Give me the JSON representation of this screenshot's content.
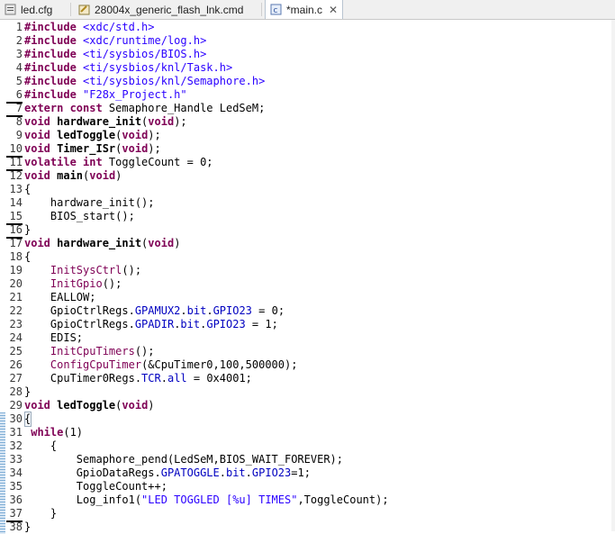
{
  "tabs": [
    {
      "label": "led.cfg",
      "icon": "config-file-icon",
      "active": false
    },
    {
      "label": "28004x_generic_flash_lnk.cmd",
      "icon": "linker-file-icon",
      "active": false
    },
    {
      "label": "*main.c",
      "icon": "c-source-file-icon",
      "active": true
    }
  ],
  "close_glyph": "✕",
  "lines": [
    {
      "n": "1",
      "mark": false,
      "tokens": [
        [
          "dir",
          "#include "
        ],
        [
          "str",
          "<xdc/std.h>"
        ]
      ]
    },
    {
      "n": "2",
      "mark": false,
      "tokens": [
        [
          "dir",
          "#include "
        ],
        [
          "str",
          "<xdc/runtime/log.h>"
        ]
      ]
    },
    {
      "n": "3",
      "mark": false,
      "tokens": [
        [
          "dir",
          "#include "
        ],
        [
          "str",
          "<ti/sysbios/BIOS.h>"
        ]
      ]
    },
    {
      "n": "4",
      "mark": false,
      "tokens": [
        [
          "dir",
          "#include "
        ],
        [
          "str",
          "<ti/sysbios/knl/Task.h>"
        ]
      ]
    },
    {
      "n": "5",
      "mark": false,
      "tokens": [
        [
          "dir",
          "#include "
        ],
        [
          "str",
          "<ti/sysbios/knl/Semaphore.h>"
        ]
      ]
    },
    {
      "n": "6",
      "mark": true,
      "tokens": [
        [
          "dir",
          "#include "
        ],
        [
          "str",
          "\"F28x_Project.h\""
        ]
      ]
    },
    {
      "n": "7",
      "mark": true,
      "tokens": [
        [
          "kw",
          "extern const "
        ],
        [
          "plain",
          "Semaphore_Handle LedSeM;"
        ]
      ]
    },
    {
      "n": "8",
      "mark": false,
      "tokens": [
        [
          "kw",
          "void "
        ],
        [
          "fn",
          "hardware_init"
        ],
        [
          "plain",
          "("
        ],
        [
          "kw",
          "void"
        ],
        [
          "plain",
          ");"
        ]
      ]
    },
    {
      "n": "9",
      "mark": false,
      "tokens": [
        [
          "kw",
          "void "
        ],
        [
          "fn",
          "ledToggle"
        ],
        [
          "plain",
          "("
        ],
        [
          "kw",
          "void"
        ],
        [
          "plain",
          ");"
        ]
      ]
    },
    {
      "n": "10",
      "mark": true,
      "tokens": [
        [
          "kw",
          "void "
        ],
        [
          "fn",
          "Timer_ISr"
        ],
        [
          "plain",
          "("
        ],
        [
          "kw",
          "void"
        ],
        [
          "plain",
          ");"
        ]
      ]
    },
    {
      "n": "11",
      "mark": true,
      "tokens": [
        [
          "kw",
          "volatile int "
        ],
        [
          "plain",
          "ToggleCount = 0;"
        ]
      ]
    },
    {
      "n": "12",
      "mark": false,
      "tokens": [
        [
          "kw",
          "void "
        ],
        [
          "fn",
          "main"
        ],
        [
          "plain",
          "("
        ],
        [
          "kw",
          "void"
        ],
        [
          "plain",
          ")"
        ]
      ]
    },
    {
      "n": "13",
      "mark": false,
      "tokens": [
        [
          "plain",
          "{"
        ]
      ]
    },
    {
      "n": "14",
      "mark": false,
      "tokens": [
        [
          "plain",
          "    hardware_init();"
        ]
      ]
    },
    {
      "n": "15",
      "mark": true,
      "tokens": [
        [
          "plain",
          "    BIOS_start();"
        ]
      ]
    },
    {
      "n": "16",
      "mark": true,
      "tokens": [
        [
          "plain",
          "}"
        ]
      ]
    },
    {
      "n": "17",
      "mark": false,
      "tokens": [
        [
          "kw",
          "void "
        ],
        [
          "fn",
          "hardware_init"
        ],
        [
          "plain",
          "("
        ],
        [
          "kw",
          "void"
        ],
        [
          "plain",
          ")"
        ]
      ]
    },
    {
      "n": "18",
      "mark": false,
      "tokens": [
        [
          "plain",
          "{"
        ]
      ]
    },
    {
      "n": "19",
      "mark": false,
      "tokens": [
        [
          "plain",
          "    "
        ],
        [
          "call",
          "InitSysCtrl"
        ],
        [
          "plain",
          "();"
        ]
      ]
    },
    {
      "n": "20",
      "mark": false,
      "tokens": [
        [
          "plain",
          "    "
        ],
        [
          "call",
          "InitGpio"
        ],
        [
          "plain",
          "();"
        ]
      ]
    },
    {
      "n": "21",
      "mark": false,
      "tokens": [
        [
          "plain",
          "    EALLOW;"
        ]
      ]
    },
    {
      "n": "22",
      "mark": false,
      "tokens": [
        [
          "plain",
          "    GpioCtrlRegs."
        ],
        [
          "field",
          "GPAMUX2"
        ],
        [
          "plain",
          "."
        ],
        [
          "field",
          "bit"
        ],
        [
          "plain",
          "."
        ],
        [
          "field",
          "GPIO23"
        ],
        [
          "plain",
          " = 0;"
        ]
      ]
    },
    {
      "n": "23",
      "mark": false,
      "tokens": [
        [
          "plain",
          "    GpioCtrlRegs."
        ],
        [
          "field",
          "GPADIR"
        ],
        [
          "plain",
          "."
        ],
        [
          "field",
          "bit"
        ],
        [
          "plain",
          "."
        ],
        [
          "field",
          "GPIO23"
        ],
        [
          "plain",
          " = 1;"
        ]
      ]
    },
    {
      "n": "24",
      "mark": false,
      "tokens": [
        [
          "plain",
          "    EDIS;"
        ]
      ]
    },
    {
      "n": "25",
      "mark": false,
      "tokens": [
        [
          "plain",
          "    "
        ],
        [
          "call",
          "InitCpuTimers"
        ],
        [
          "plain",
          "();"
        ]
      ]
    },
    {
      "n": "26",
      "mark": false,
      "tokens": [
        [
          "plain",
          "    "
        ],
        [
          "call",
          "ConfigCpuTimer"
        ],
        [
          "plain",
          "(&CpuTimer0,100,500000);"
        ]
      ]
    },
    {
      "n": "27",
      "mark": false,
      "tokens": [
        [
          "plain",
          "    CpuTimer0Regs."
        ],
        [
          "field",
          "TCR"
        ],
        [
          "plain",
          "."
        ],
        [
          "field",
          "all"
        ],
        [
          "plain",
          " = 0x4001;"
        ]
      ]
    },
    {
      "n": "28",
      "mark": false,
      "tokens": [
        [
          "plain",
          "}"
        ]
      ]
    },
    {
      "n": "29",
      "mark": false,
      "tokens": [
        [
          "kw",
          "void "
        ],
        [
          "fn",
          "ledToggle"
        ],
        [
          "plain",
          "("
        ],
        [
          "kw",
          "void"
        ],
        [
          "plain",
          ")"
        ]
      ]
    },
    {
      "n": "30",
      "mark": false,
      "tokens": [
        [
          "plain",
          "{"
        ]
      ]
    },
    {
      "n": "31",
      "mark": false,
      "tokens": [
        [
          "plain",
          " "
        ],
        [
          "kw",
          "while"
        ],
        [
          "plain",
          "(1)"
        ]
      ]
    },
    {
      "n": "32",
      "mark": false,
      "tokens": [
        [
          "plain",
          "    {"
        ]
      ]
    },
    {
      "n": "33",
      "mark": false,
      "tokens": [
        [
          "plain",
          "        Semaphore_pend(LedSeM,BIOS_WAIT_FOREVER);"
        ]
      ]
    },
    {
      "n": "34",
      "mark": false,
      "tokens": [
        [
          "plain",
          "        GpioDataRegs."
        ],
        [
          "field",
          "GPATOGGLE"
        ],
        [
          "plain",
          "."
        ],
        [
          "field",
          "bit"
        ],
        [
          "plain",
          "."
        ],
        [
          "field",
          "GPIO23"
        ],
        [
          "plain",
          "=1;"
        ]
      ]
    },
    {
      "n": "35",
      "mark": false,
      "tokens": [
        [
          "plain",
          "        ToggleCount++;"
        ]
      ]
    },
    {
      "n": "36",
      "mark": false,
      "tokens": [
        [
          "plain",
          "        Log_info1("
        ],
        [
          "str",
          "\"LED TOGGLED [%u] TIMES\""
        ],
        [
          "plain",
          ",ToggleCount);"
        ]
      ]
    },
    {
      "n": "37",
      "mark": true,
      "tokens": [
        [
          "plain",
          "    }"
        ]
      ]
    },
    {
      "n": "38",
      "mark": false,
      "tokens": [
        [
          "plain",
          "}"
        ]
      ]
    }
  ]
}
